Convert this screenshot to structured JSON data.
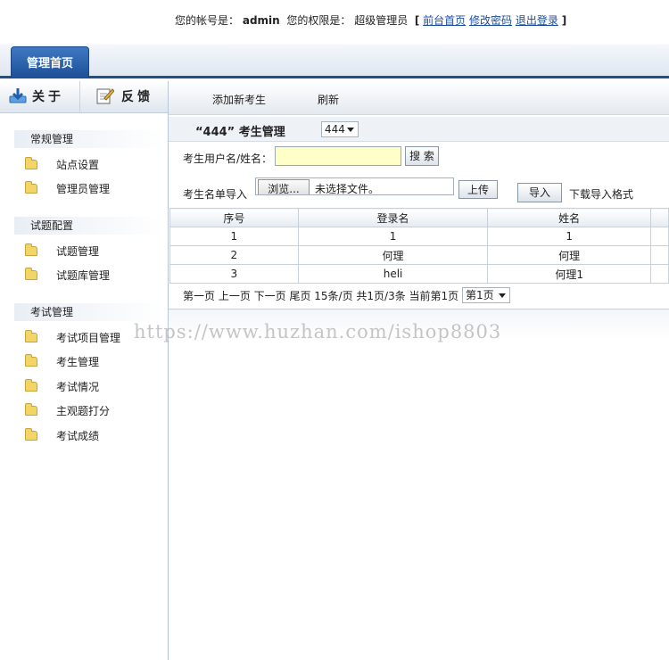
{
  "header": {
    "account_label": "您的帐号是：",
    "account_value": "admin",
    "role_label": "您的权限是：",
    "role_value": "超级管理员",
    "bracket_open": "[",
    "bracket_close": "]",
    "links": [
      "前台首页",
      "修改密码",
      "退出登录"
    ]
  },
  "tabs": {
    "home": "管理首页"
  },
  "sidebar": {
    "about": "关于",
    "feedback": "反馈",
    "groups": [
      {
        "title": "常规管理",
        "items": [
          "站点设置",
          "管理员管理"
        ]
      },
      {
        "title": "试题配置",
        "items": [
          "试题管理",
          "试题库管理"
        ]
      },
      {
        "title": "考试管理",
        "items": [
          "考试项目管理",
          "考生管理",
          "考试情况",
          "主观题打分",
          "考试成绩"
        ]
      }
    ]
  },
  "toolbar": {
    "add": "添加新考生",
    "refresh": "刷新"
  },
  "main": {
    "title": "“444” 考生管理",
    "exam_select": "444",
    "search_label": "考生用户名/姓名：",
    "search_value": "",
    "search_button": "搜 索",
    "import_label": "考生名单导入",
    "browse_button": "浏览...",
    "file_status": "未选择文件。",
    "upload_button": "上传",
    "import_button": "导入",
    "download_format": "下载导入格式"
  },
  "table": {
    "headers": [
      "序号",
      "登录名",
      "姓名"
    ],
    "rows": [
      [
        "1",
        "1",
        "1"
      ],
      [
        "2",
        "何理",
        "何理"
      ],
      [
        "3",
        "heli",
        "何理1"
      ]
    ]
  },
  "pager": {
    "text": "第一页 上一页 下一页 尾页 15条/页 共1页/3条 当前第1页",
    "page_select": "第1页"
  },
  "watermark": "https://www.huzhan.com/ishop8803"
}
